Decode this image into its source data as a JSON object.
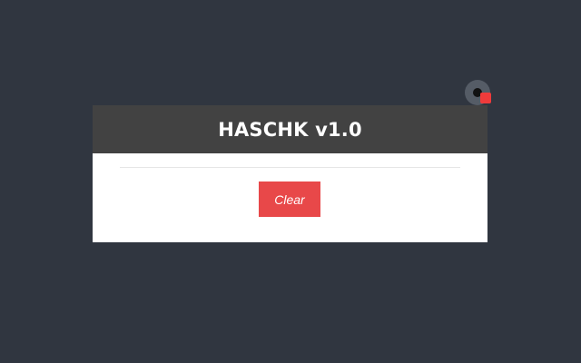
{
  "dialog": {
    "title": "HASCHK v1.0",
    "clear_label": "Clear"
  },
  "colors": {
    "background": "#303640",
    "header": "#424242",
    "button": "#e84849",
    "badge": "#ef3b3b"
  },
  "icons": {
    "corner_toggle": "record-toggle-icon",
    "status_badge": "red-square-badge-icon"
  }
}
